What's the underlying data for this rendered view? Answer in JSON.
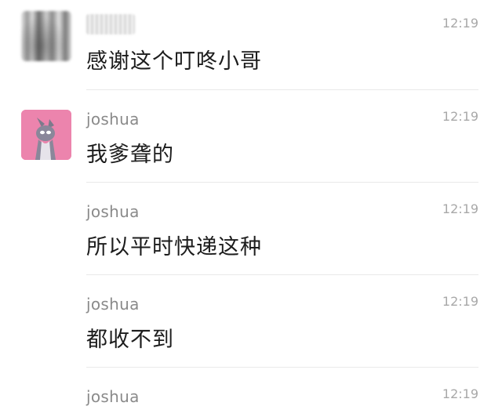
{
  "messages": [
    {
      "sender": "",
      "time": "12:19",
      "text": "感谢这个叮咚小哥"
    },
    {
      "sender": "joshua",
      "time": "12:19",
      "text": "我爹聋的"
    },
    {
      "sender": "joshua",
      "time": "12:19",
      "text": "所以平时快递这种"
    },
    {
      "sender": "joshua",
      "time": "12:19",
      "text": "都收不到"
    },
    {
      "sender": "joshua",
      "time": "12:19",
      "text": ""
    }
  ]
}
